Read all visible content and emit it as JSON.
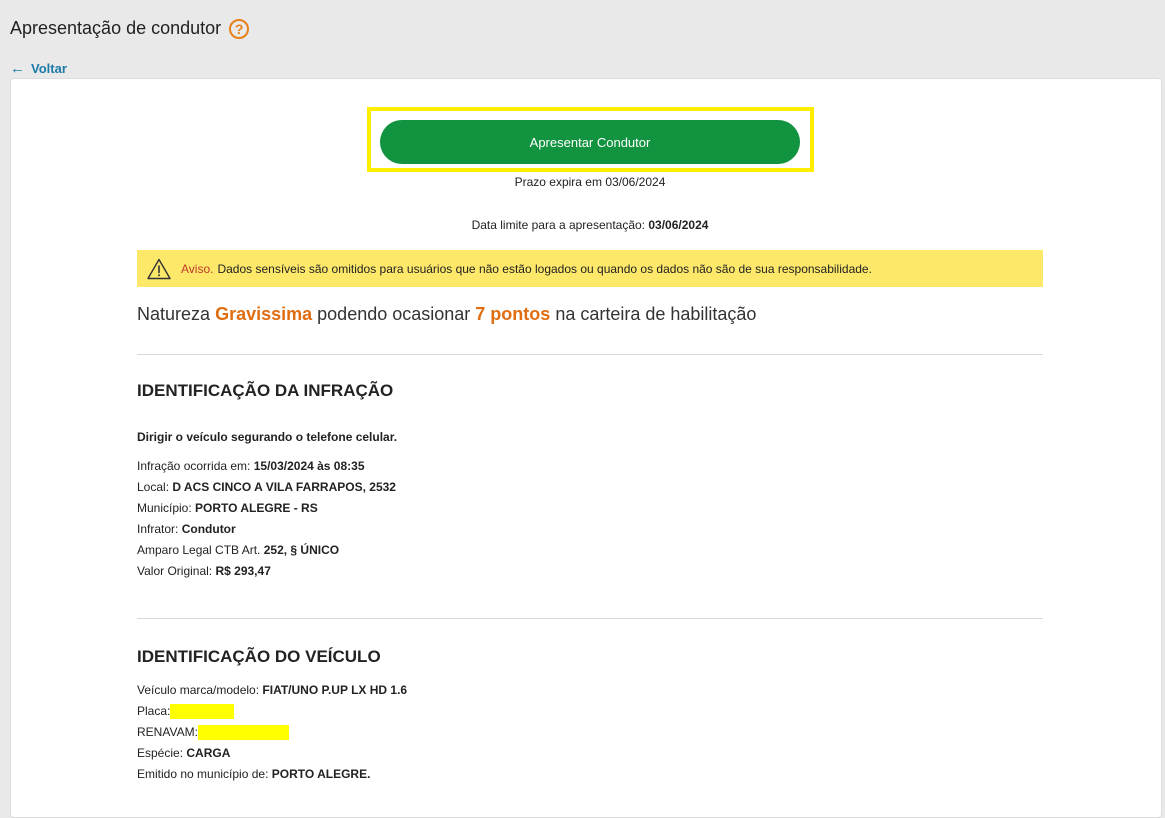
{
  "header": {
    "title": "Apresentação de condutor",
    "help_icon": "?",
    "back_label": "Voltar"
  },
  "actions": {
    "present_label": "Apresentar Condutor",
    "deadline_text": "Prazo expira em 03/06/2024",
    "limit_label": "Data limite para a apresentação:",
    "limit_value": "03/06/2024"
  },
  "warning": {
    "label": "Aviso.",
    "text": "Dados sensíveis são omitidos para usuários que não estão logados ou quando os dados não são de sua responsabilidade."
  },
  "nature": {
    "prefix": "Natureza",
    "severity": "Gravissima",
    "middle": "podendo ocasionar",
    "points": "7 pontos",
    "suffix": "na carteira de habilitação"
  },
  "infraction": {
    "heading": "IDENTIFICAÇÃO DA INFRAÇÃO",
    "description": "Dirigir o veículo segurando o telefone celular.",
    "fields": [
      {
        "label": "Infração ocorrida em:",
        "value": "15/03/2024 às 08:35"
      },
      {
        "label": "Local:",
        "value": "D ACS CINCO A VILA FARRAPOS, 2532"
      },
      {
        "label": "Município:",
        "value": "PORTO ALEGRE - RS"
      },
      {
        "label": "Infrator:",
        "value": "Condutor"
      },
      {
        "label": "Amparo Legal CTB Art.",
        "value": "252, § ÚNICO"
      },
      {
        "label": "Valor Original:",
        "value": "R$ 293,47"
      }
    ]
  },
  "vehicle": {
    "heading": "IDENTIFICAÇÃO DO VEÍCULO",
    "model_label": "Veículo marca/modelo:",
    "model_value": "FIAT/UNO P.UP LX HD 1.6",
    "plate_label": "Placa:",
    "renavam_label": "RENAVAM:",
    "species_label": "Espécie:",
    "species_value": "CARGA",
    "issued_label": "Emitido no município de:",
    "issued_value": "PORTO ALEGRE."
  },
  "colors": {
    "primary_button": "#129340",
    "highlight": "#ffee00",
    "warning_bg": "#fde86a",
    "accent": "#e06d10",
    "link": "#1b7aa8",
    "redaction": "#ffff00"
  },
  "icons": {
    "help": "question-circle-icon",
    "back": "arrow-left-icon",
    "warning": "warning-triangle-icon"
  }
}
